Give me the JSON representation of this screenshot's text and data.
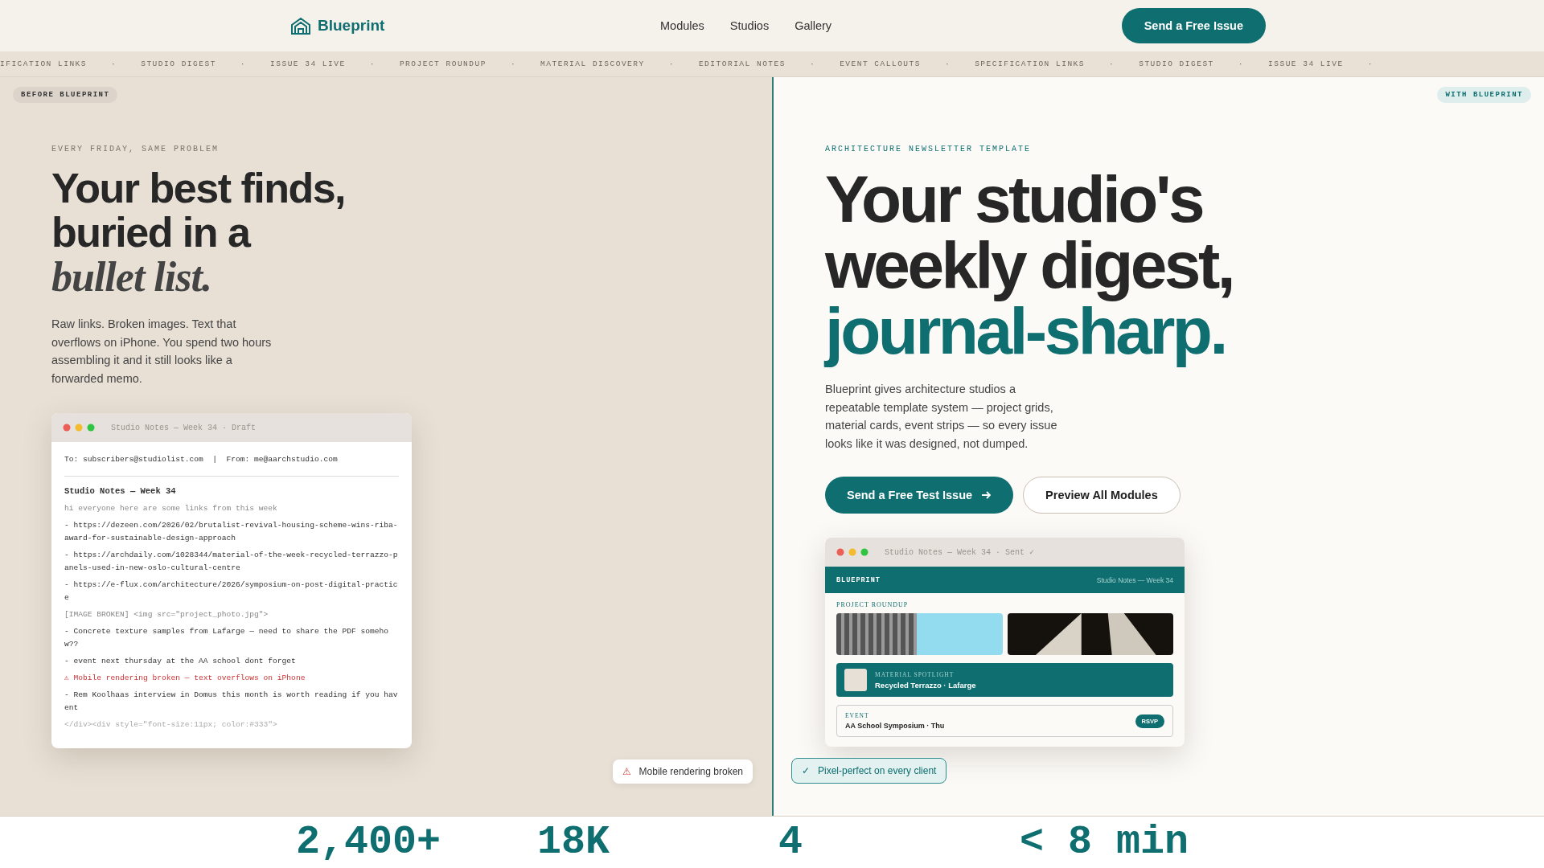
{
  "nav": {
    "logo": "Blueprint",
    "links": [
      "Modules",
      "Studios",
      "Gallery"
    ],
    "cta": "Send a Free Issue"
  },
  "ticker": {
    "separator": "·",
    "items": [
      "IFICATION LINKS",
      "STUDIO DIGEST",
      "ISSUE 34 LIVE",
      "PROJECT ROUNDUP",
      "MATERIAL DISCOVERY",
      "EDITORIAL NOTES",
      "EVENT CALLOUTS",
      "SPECIFICATION LINKS",
      "STUDIO DIGEST",
      "ISSUE 34 LIVE"
    ]
  },
  "before": {
    "badge": "BEFORE BLUEPRINT",
    "eyebrow": "EVERY FRIDAY, SAME PROBLEM",
    "heading_lines": [
      "Your best finds,",
      "buried in a"
    ],
    "heading_italic": "bullet list.",
    "body": "Raw links. Broken images. Text that overflows on iPhone. You spend two hours assembling it and it still looks like a forwarded memo.",
    "email": {
      "title": "Studio Notes — Week 34 · Draft",
      "header": "To: subscribers@studiolist.com  |  From: me@aarchstudio.com",
      "subject": "Studio Notes — Week 34",
      "lines": [
        {
          "kind": "muted",
          "text": "hi everyone here are some links from this week"
        },
        {
          "kind": "text",
          "text": "- https://dezeen.com/2026/02/brutalist-revival-housing-scheme-wins-riba-award-for-sustainable-design-approach"
        },
        {
          "kind": "text",
          "text": "- https://archdaily.com/1028344/material-of-the-week-recycled-terrazzo-panels-used-in-new-oslo-cultural-centre"
        },
        {
          "kind": "text",
          "text": "- https://e-flux.com/architecture/2026/symposium-on-post-digital-practice"
        },
        {
          "kind": "muted",
          "text": "[IMAGE BROKEN] <img src=\"project_photo.jpg\">"
        },
        {
          "kind": "text",
          "text": "- Concrete texture samples from Lafarge — need to share the PDF somehow??"
        },
        {
          "kind": "text",
          "text": "- event next thursday at the AA school dont forget"
        },
        {
          "kind": "warning",
          "text": "⚠ Mobile rendering broken — text overflows on iPhone"
        },
        {
          "kind": "text",
          "text": "- Rem Koolhaas interview in Domus this month is worth reading if you havent"
        },
        {
          "kind": "code",
          "text": "</div><div style=\"font-size:11px; color:#333\">"
        }
      ]
    },
    "flag": {
      "icon": "⚠",
      "text": "Mobile rendering broken"
    }
  },
  "after": {
    "badge": "WITH BLUEPRINT",
    "eyebrow": "ARCHITECTURE NEWSLETTER TEMPLATE",
    "heading_lines": [
      "Your studio's",
      "weekly digest,"
    ],
    "heading_accent": "journal-sharp.",
    "body": "Blueprint gives architecture studios a repeatable template system — project grids, material cards, event strips — so every issue looks like it was designed, not dumped.",
    "buttons": [
      {
        "kind": "primary",
        "label": "Send a Free Test Issue"
      },
      {
        "kind": "secondary",
        "label": "Preview All Modules"
      }
    ],
    "mock": {
      "title": "Studio Notes — Week 34 · Sent ✓",
      "brand": "BLUEPRINT",
      "issue": "Studio Notes — Week 34",
      "section": "PROJECT ROUNDUP",
      "spotlight": {
        "label": "MATERIAL SPOTLIGHT",
        "title": "Recycled Terrazzo · Lafarge"
      },
      "event": {
        "label": "EVENT",
        "title": "AA School Symposium · Thu",
        "action": "RSVP"
      }
    },
    "flag": {
      "icon": "✓",
      "text": "Pixel-perfect on every client"
    }
  },
  "stats": [
    "2,400+",
    "18K",
    "4",
    "< 8 min"
  ]
}
